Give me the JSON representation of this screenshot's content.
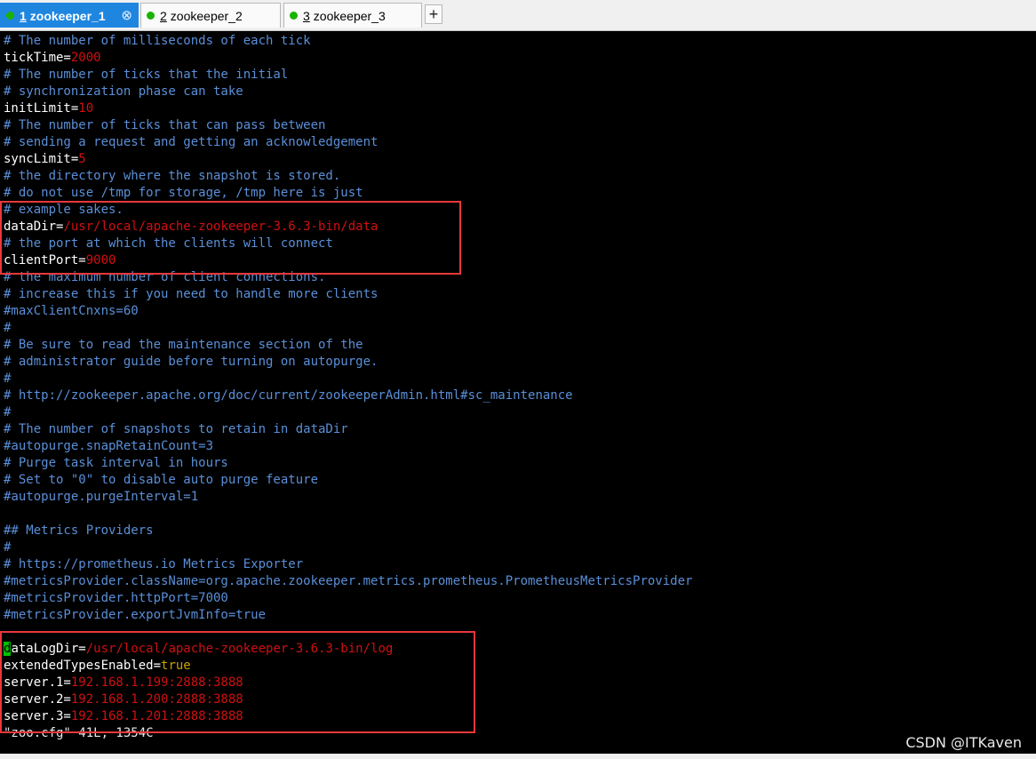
{
  "tabs": [
    {
      "num": "1",
      "label": "zookeeper_1",
      "close": "⊗"
    },
    {
      "num": "2",
      "label": "zookeeper_2"
    },
    {
      "num": "3",
      "label": "zookeeper_3"
    }
  ],
  "new_tab_label": "+",
  "colors": {
    "comment": "#5a8fd8",
    "value": "#d01010",
    "keyword": "#c8a000",
    "cursor": "#00c000",
    "highlight_box": "#e8383b",
    "active_tab": "#1f86e0",
    "tab_dot": "#19b300"
  },
  "lines": [
    {
      "c": "# The number of milliseconds of each tick"
    },
    {
      "k": "tickTime=",
      "v": "2000"
    },
    {
      "c": "# The number of ticks that the initial"
    },
    {
      "c": "# synchronization phase can take"
    },
    {
      "k": "initLimit=",
      "v": "10"
    },
    {
      "c": "# The number of ticks that can pass between"
    },
    {
      "c": "# sending a request and getting an acknowledgement"
    },
    {
      "k": "syncLimit=",
      "v": "5"
    },
    {
      "c": "# the directory where the snapshot is stored."
    },
    {
      "c": "# do not use /tmp for storage, /tmp here is just"
    },
    {
      "c": "# example sakes."
    },
    {
      "k": "dataDir=",
      "v": "/usr/local/apache-zookeeper-3.6.3-bin/data"
    },
    {
      "c": "# the port at which the clients will connect"
    },
    {
      "k": "clientPort=",
      "v": "9000"
    },
    {
      "c": "# the maximum number of client connections."
    },
    {
      "c": "# increase this if you need to handle more clients"
    },
    {
      "c": "#maxClientCnxns=60"
    },
    {
      "c": "#"
    },
    {
      "c": "# Be sure to read the maintenance section of the"
    },
    {
      "c": "# administrator guide before turning on autopurge."
    },
    {
      "c": "#"
    },
    {
      "c": "# http://zookeeper.apache.org/doc/current/zookeeperAdmin.html#sc_maintenance"
    },
    {
      "c": "#"
    },
    {
      "c": "# The number of snapshots to retain in dataDir"
    },
    {
      "c": "#autopurge.snapRetainCount=3"
    },
    {
      "c": "# Purge task interval in hours"
    },
    {
      "c": "# Set to \"0\" to disable auto purge feature"
    },
    {
      "c": "#autopurge.purgeInterval=1"
    },
    {
      "c": ""
    },
    {
      "c": "## Metrics Providers"
    },
    {
      "c": "#"
    },
    {
      "c": "# https://prometheus.io Metrics Exporter"
    },
    {
      "c": "#metricsProvider.className=org.apache.zookeeper.metrics.prometheus.PrometheusMetricsProvider"
    },
    {
      "c": "#metricsProvider.httpPort=7000"
    },
    {
      "c": "#metricsProvider.exportJvmInfo=true"
    },
    {
      "c": ""
    },
    {
      "cursor": "d",
      "k": "ataLogDir=",
      "v": "/usr/local/apache-zookeeper-3.6.3-bin/log"
    },
    {
      "k": "extendedTypesEnabled=",
      "b": "true"
    },
    {
      "k": "server.1=",
      "v": "192.168.1.199:2888:3888"
    },
    {
      "k": "server.2=",
      "v": "192.168.1.200:2888:3888"
    },
    {
      "k": "server.3=",
      "v": "192.168.1.201:2888:3888"
    },
    {
      "s": "\"zoo.cfg\" 41L, 1354C"
    }
  ],
  "watermark": "CSDN @ITKaven"
}
